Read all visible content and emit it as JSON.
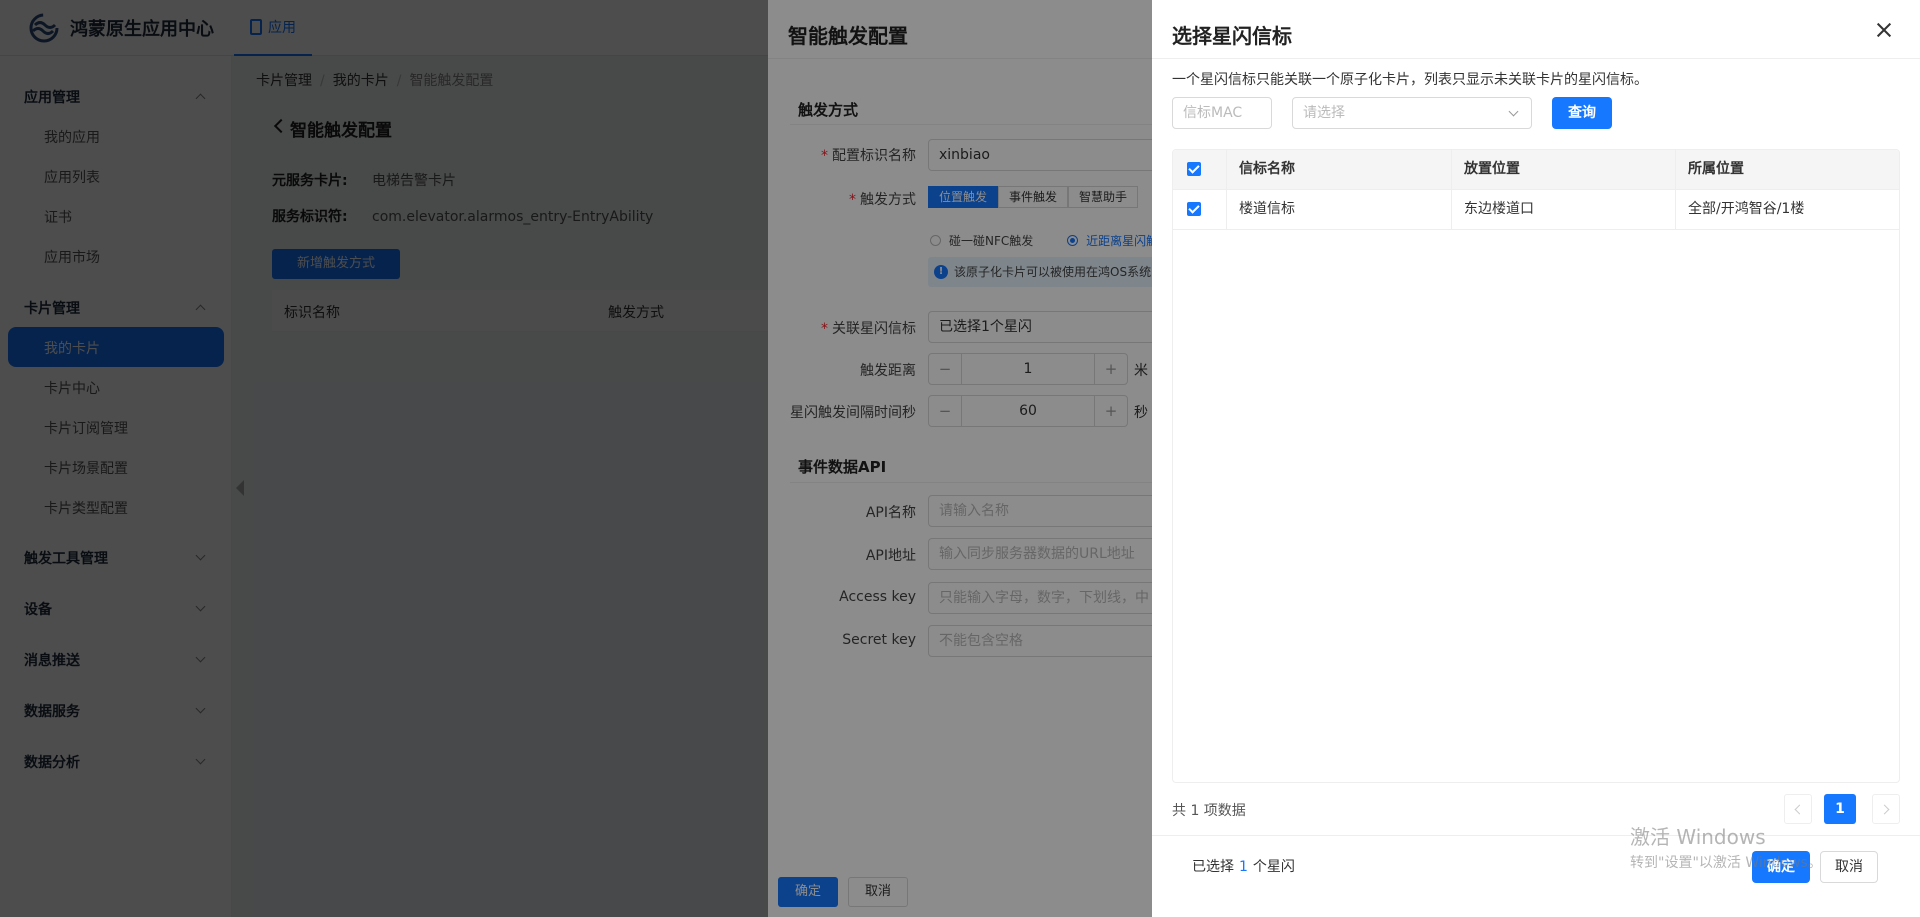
{
  "app": {
    "name": "鸿蒙原生应用中心",
    "top_nav": "应用"
  },
  "sidebar": {
    "groups": [
      {
        "label": "应用管理",
        "items": [
          "我的应用",
          "应用列表",
          "证书",
          "应用市场"
        ]
      },
      {
        "label": "卡片管理",
        "items": [
          "我的卡片",
          "卡片中心",
          "卡片订阅管理",
          "卡片场景配置",
          "卡片类型配置"
        ]
      },
      {
        "label": "触发工具管理"
      },
      {
        "label": "设备"
      },
      {
        "label": "消息推送"
      },
      {
        "label": "数据服务"
      },
      {
        "label": "数据分析"
      }
    ]
  },
  "breadcrumb": [
    "卡片管理",
    "我的卡片",
    "智能触发配置"
  ],
  "page": {
    "title": "智能触发配置",
    "service_card_label": "元服务卡片:",
    "service_card_value": "电梯告警卡片",
    "service_id_label": "服务标识符:",
    "service_id_value": "com.elevator.alarmos_entry-EntryAbility",
    "new_button": "新增触发方式",
    "table_headers": [
      "标识名称",
      "触发方式"
    ]
  },
  "config_drawer": {
    "title": "智能触发配置",
    "section_trigger": "触发方式",
    "name_label": "配置标识名称",
    "name_value": "xinbiao",
    "trigger_label": "触发方式",
    "trigger_tabs": [
      "位置触发",
      "事件触发",
      "智慧助手"
    ],
    "radios": [
      "碰一碰NFC触发",
      "近距离星闪触"
    ],
    "hint": "该原子化卡片可以被使用在鸿OS系统的",
    "beacon_label": "关联星闪信标",
    "beacon_value": "已选择1个星闪",
    "distance_label": "触发距离",
    "distance_value": "1",
    "distance_unit": "米",
    "interval_label": "星闪触发间隔时间秒",
    "interval_value": "60",
    "interval_unit": "秒",
    "section_api": "事件数据API",
    "api_name_label": "API名称",
    "api_name_placeholder": "请输入名称",
    "api_url_label": "API地址",
    "api_url_placeholder": "输入同步服务器数据的URL地址",
    "access_key_label": "Access key",
    "access_key_placeholder": "只能输入字母，数字，下划线，中",
    "secret_key_label": "Secret key",
    "secret_key_placeholder": "不能包含空格",
    "ok": "确定",
    "cancel": "取消"
  },
  "beacon_drawer": {
    "title": "选择星闪信标",
    "description": "一个星闪信标只能关联一个原子化卡片，列表只显示未关联卡片的星闪信标。",
    "mac_placeholder": "信标MAC",
    "select_placeholder": "请选择",
    "query_button": "查询",
    "columns": [
      "信标名称",
      "放置位置",
      "所属位置"
    ],
    "rows": [
      {
        "name": "楼道信标",
        "placement": "东边楼道口",
        "location": "全部/开鸿智谷/1楼",
        "checked": true
      }
    ],
    "total_text": "共 1 项数据",
    "current_page": "1",
    "selected_prefix": "已选择",
    "selected_count": "1",
    "selected_suffix": "个星闪",
    "ok": "确定",
    "cancel": "取消"
  },
  "watermark": {
    "line1": "激活 Windows",
    "line2": "转到\"设置\"以激活 Windows。"
  },
  "colors": {
    "primary": "#1677ff",
    "required": "#f5222d",
    "mask": "rgba(0,0,0,0.45)"
  }
}
